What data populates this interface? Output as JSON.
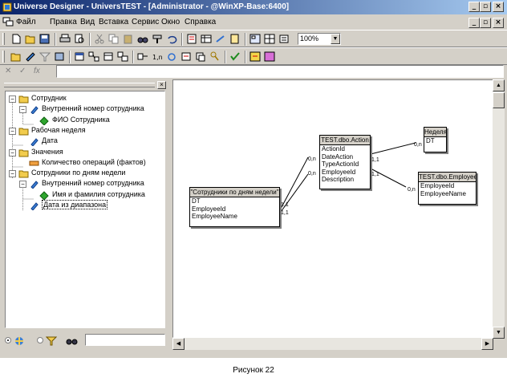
{
  "window": {
    "title": "Universe Designer - UniversTEST - [Administrator - @WinXP-Base:6400]"
  },
  "menu": [
    "Файл",
    "Правка",
    "Вид",
    "Вставка",
    "Сервис",
    "Окно",
    "Справка"
  ],
  "toolbar": {
    "zoom": "100%"
  },
  "tree": {
    "nodes": [
      {
        "label": "Сотрудник",
        "kind": "class",
        "expanded": true
      },
      {
        "label": "Внутренний номер сотрудника",
        "kind": "dimension",
        "expanded": true
      },
      {
        "label": "ФИО Сотрудника",
        "kind": "detail"
      },
      {
        "label": "Рабочая неделя",
        "kind": "class",
        "expanded": true
      },
      {
        "label": "Дата",
        "kind": "dimension"
      },
      {
        "label": "Значения",
        "kind": "class",
        "expanded": true
      },
      {
        "label": "Количество операций (фактов)",
        "kind": "measure"
      },
      {
        "label": "Сотрудники по дням недели",
        "kind": "class",
        "expanded": true
      },
      {
        "label": "Внутренний номер сотрудника",
        "kind": "dimension",
        "expanded": true
      },
      {
        "label": "Имя и фамилия сотрудника",
        "kind": "detail"
      },
      {
        "label": "Дата из диапазона",
        "kind": "dimension",
        "selected": true
      }
    ]
  },
  "schema": {
    "tables": [
      {
        "name": "\"Сотрудники по дням недели\"",
        "columns": [
          "DT",
          "EmployeeId",
          "EmployeeName"
        ]
      },
      {
        "name": "TEST.dbo.Action",
        "columns": [
          "ActionId",
          "DateAction",
          "TypeActionId",
          "EmployeeId",
          "Description"
        ]
      },
      {
        "name": "Неделя",
        "columns": [
          "DT"
        ]
      },
      {
        "name": "TEST.dbo.Employee",
        "columns": [
          "EmployeeId",
          "EmployeeName"
        ]
      }
    ],
    "cardinalities": [
      "0,n",
      "1,1",
      "0,n",
      "1,1",
      "1,1",
      "0,n",
      "0,n",
      "1,1"
    ]
  },
  "caption": "Рисунок 22"
}
